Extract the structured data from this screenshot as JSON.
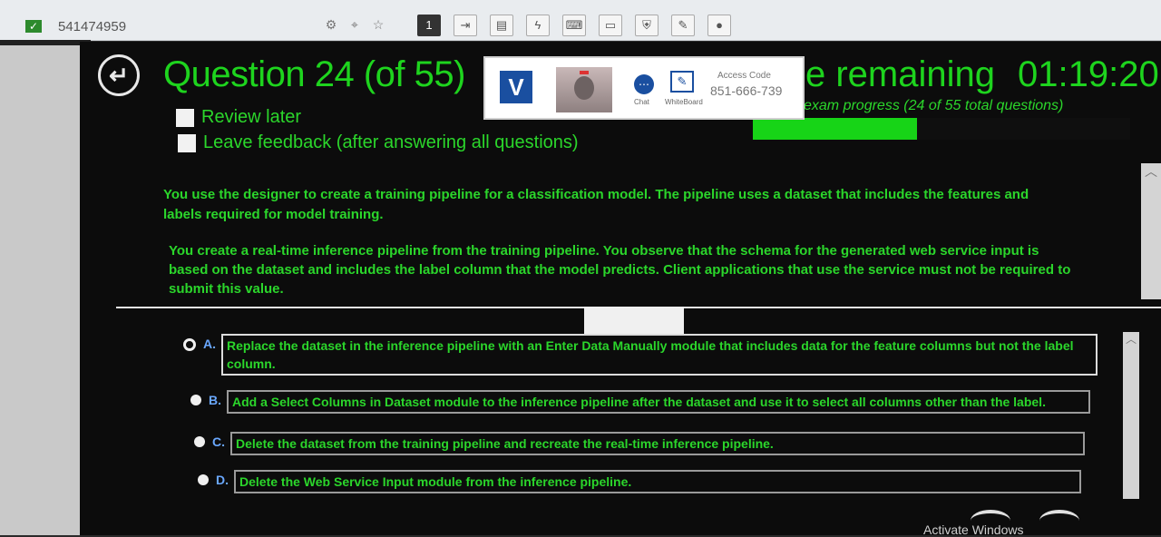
{
  "browser": {
    "id_text": "541474959",
    "check_icon": "check-icon",
    "tool_icons": [
      "settings-icon",
      "pin-icon",
      "star-icon"
    ],
    "toolbar_buttons": [
      "1",
      "calculator-icon",
      "comment-icon",
      "flash-icon",
      "keyboard-icon",
      "monitor-icon",
      "shield-icon",
      "pen-icon",
      "record-icon"
    ]
  },
  "exam": {
    "title": "Question 24 (of 55)",
    "review_later": "Review later",
    "leave_feedback": "Leave feedback (after answering all questions)",
    "time_label": "e remaining",
    "time_value": "01:19:20",
    "progress_label": "exam progress (24 of 55 total questions)",
    "progress_fraction": 0.436,
    "accent_color": "#1ed41e"
  },
  "proctor": {
    "logo": "V",
    "chat_label": "Chat",
    "whiteboard_label": "WhiteBoard",
    "access_code_label": "Access Code",
    "access_code": "851-666-739"
  },
  "question": {
    "stem_paragraph_1": "You use the designer to create a training pipeline for a classification model. The pipeline uses a dataset that includes the features and labels required for model training.",
    "stem_paragraph_2": "You create a real-time inference pipeline from the training pipeline. You observe that the schema for the generated web service input is based on the dataset and includes the label column that the model predicts. Client applications that use the service must not be required to submit this value."
  },
  "options": [
    {
      "letter": "A.",
      "text": "Replace the dataset in the inference pipeline with an Enter Data Manually module that includes data for the feature columns but not the label column.",
      "selected": true
    },
    {
      "letter": "B.",
      "text": "Add a Select Columns in Dataset module to the inference pipeline after the dataset and use it to select all columns other than the label.",
      "selected": false
    },
    {
      "letter": "C.",
      "text": "Delete the dataset from the training pipeline and recreate the real-time inference pipeline.",
      "selected": false
    },
    {
      "letter": "D.",
      "text": "Delete the Web Service Input module from the inference pipeline.",
      "selected": false
    }
  ],
  "watermark": "Activate Windows"
}
